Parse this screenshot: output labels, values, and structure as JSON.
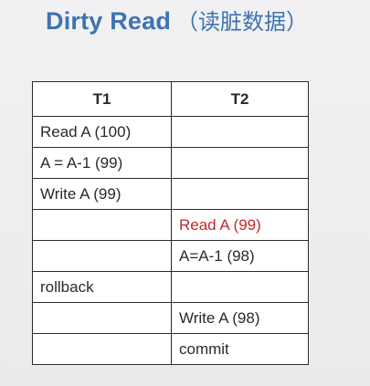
{
  "slide": {
    "title_en": "Dirty Read",
    "title_cn": "（读脏数据）",
    "accent_color": "#3f73b0",
    "highlight_color": "#c0282d"
  },
  "table": {
    "headers": [
      "T1",
      "T2"
    ],
    "rows": [
      [
        "Read A  (100)",
        ""
      ],
      [
        "A = A-1 (99)",
        ""
      ],
      [
        "Write A (99)",
        ""
      ],
      [
        "",
        "Read A (99)"
      ],
      [
        "",
        "A=A-1 (98)"
      ],
      [
        "rollback",
        ""
      ],
      [
        "",
        "Write A (98)"
      ],
      [
        "",
        "commit"
      ]
    ]
  }
}
